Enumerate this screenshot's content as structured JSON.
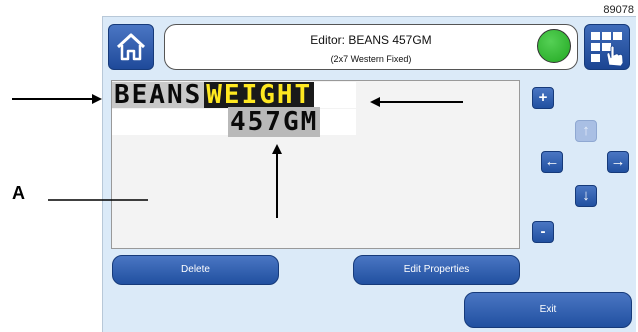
{
  "figure_id": "89078",
  "header": {
    "title": "Editor: BEANS 457GM",
    "subtitle": "(2x7 Western Fixed)"
  },
  "icons": {
    "home": "home-icon",
    "apps": "app-grid-hand-icon",
    "status": "status-indicator-green"
  },
  "colors": {
    "status_ok": "#2fb52f",
    "button_blue": "#2b5bb0",
    "screen_bg": "#dbeaf8",
    "highlight_text": "#ffe820"
  },
  "message": {
    "line1_text": "BEANS",
    "line1_highlight": "WEIGHT",
    "line2_text": "457GM"
  },
  "controls": {
    "plus": "+",
    "minus": "-",
    "up": "↑",
    "left": "←",
    "right": "→",
    "down": "↓"
  },
  "buttons": {
    "delete": "Delete",
    "edit_properties": "Edit Properties",
    "exit": "Exit"
  },
  "callouts": {
    "A": "A"
  }
}
